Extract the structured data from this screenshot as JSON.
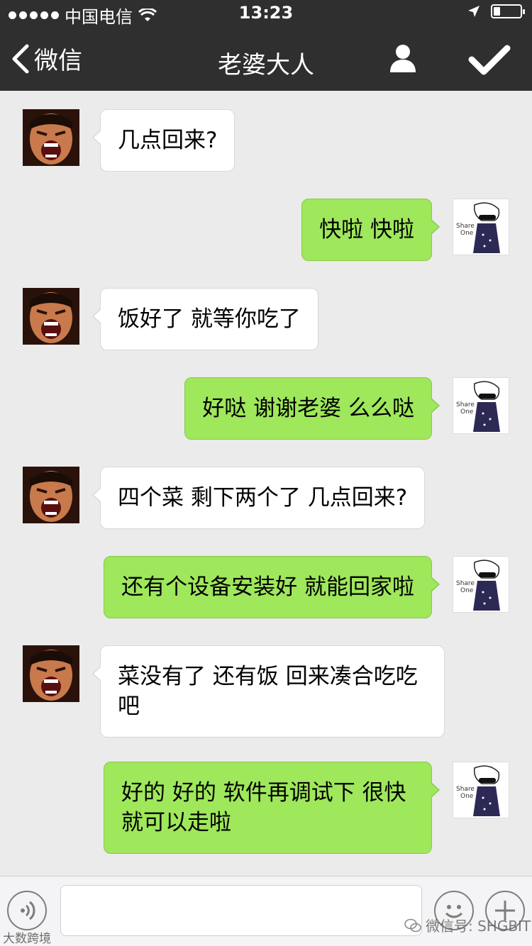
{
  "status_bar": {
    "carrier": "中国电信",
    "time": "13:23",
    "icons": [
      "signal-dots-icon",
      "wifi-icon",
      "location-arrow-icon",
      "battery-icon"
    ],
    "battery_level": 0.25
  },
  "nav": {
    "back_label": "微信",
    "title": "老婆大人",
    "icons": [
      "back-chevron-icon",
      "person-icon",
      "checkmark-icon"
    ]
  },
  "messages": [
    {
      "sender": "wife",
      "text": "几点回来?"
    },
    {
      "sender": "me",
      "text": "快啦 快啦"
    },
    {
      "sender": "wife",
      "text": "饭好了 就等你吃了"
    },
    {
      "sender": "me",
      "text": "好哒 谢谢老婆 么么哒"
    },
    {
      "sender": "wife",
      "text": "四个菜 剩下两个了 几点回来?"
    },
    {
      "sender": "me",
      "text": "还有个设备安装好 就能回家啦"
    },
    {
      "sender": "wife",
      "text": "菜没有了 还有饭 回来凑合吃吃吧"
    },
    {
      "sender": "me",
      "text": "好的 好的 软件再调试下 很快就可以走啦"
    }
  ],
  "avatars": {
    "me_caption_line1": "Share",
    "me_caption_line2": "One"
  },
  "input_bar": {
    "placeholder": "",
    "icons": [
      "voice-icon",
      "emoji-icon",
      "plus-icon"
    ]
  },
  "watermarks": {
    "left": "大数跨境",
    "right": "微信号: SHGBIT"
  },
  "colors": {
    "nav_bg": "#2f2f2f",
    "chat_bg": "#ebebeb",
    "outgoing_bubble": "#9fe75b",
    "incoming_bubble": "#ffffff"
  }
}
